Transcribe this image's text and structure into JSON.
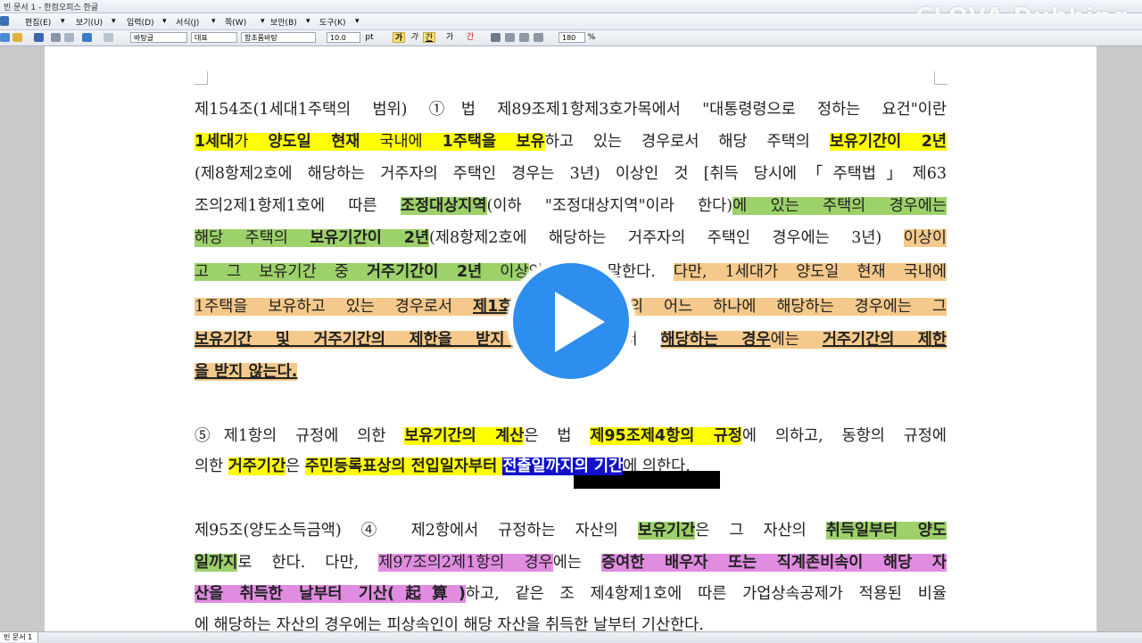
{
  "window": {
    "title": "빈 문서 1 - 한컴오피스 한글"
  },
  "watermark": "CLOVA Dubbing",
  "menu": [
    {
      "label": "편집(E)"
    },
    {
      "label": "보기(U)"
    },
    {
      "label": "입력(D)"
    },
    {
      "label": "서식(J)"
    },
    {
      "label": "쪽(W)"
    },
    {
      "label": "보안(B)"
    },
    {
      "label": "도구(K)"
    }
  ],
  "toolbar": {
    "style_value": "바탕글",
    "lang_value": "대표",
    "font_value": "함초롬바탕",
    "size_value": "10.0",
    "size_unit": "pt",
    "bold_label": "가",
    "italic_label": "가",
    "underline_label": "간",
    "strike_label": "가",
    "color_label": "간",
    "zoom_value": "180",
    "zoom_unit": "%"
  },
  "document": {
    "lines": [
      [
        {
          "t": "제154조(1세대1주택의 범위) ①법 제89조제1항제3호가목에서 \"대통령령으로 정하는 요건\"이란"
        }
      ],
      [
        {
          "t": "1세대",
          "h": "y",
          "b": 1
        },
        {
          "t": "가 ",
          "h": "y"
        },
        {
          "t": "양도일 현재",
          "h": "y",
          "b": 1
        },
        {
          "t": " 국내에 ",
          "h": "y"
        },
        {
          "t": "1주택을 보유",
          "h": "y",
          "b": 1
        },
        {
          "t": "하고 있는 경우로서 해당 주택의 "
        },
        {
          "t": "보유기간이 2년",
          "h": "y",
          "b": 1
        }
      ],
      [
        {
          "t": "(제8항제2호에 해당하는 거주자의 주택인 경우는 3년) 이상인 것 [취득 당시에「주택법」제63"
        }
      ],
      [
        {
          "t": "조의2제1항제1호에 따른 "
        },
        {
          "t": "조정대상지역",
          "h": "g",
          "b": 1
        },
        {
          "t": "(이하 \"조정대상지역\"이라 한다)"
        },
        {
          "t": "에 있는 주택의 경우에는",
          "h": "g"
        }
      ],
      [
        {
          "t": "해당 주택의 ",
          "h": "g"
        },
        {
          "t": "보유기간이 2년",
          "h": "g",
          "b": 1
        },
        {
          "t": "(제8항제2호에 해당하는 거주자의 주택인 경우에는 3년) "
        },
        {
          "t": "이상이",
          "h": "o"
        }
      ],
      [
        {
          "t": "고 그 보유기간 중 ",
          "h": "g"
        },
        {
          "t": "거주기간이 2년",
          "h": "g",
          "b": 1
        },
        {
          "t": " 이상",
          "h": "g"
        },
        {
          "t": "인 것을 말한다. "
        },
        {
          "t": "다만, 1세대가 양도일 현재 국내에",
          "h": "o"
        }
      ],
      [
        {
          "t": "1주택을 보유하고 있는 경우로서 ",
          "h": "o"
        },
        {
          "t": "제1호",
          "h": "o",
          "b": 1,
          "u": 1
        },
        {
          "t": "부터 제3호까지의 어느 하나에 해당하는 경우에는 그",
          "h": "o"
        }
      ],
      [
        {
          "t": "보유기간 및 거주기간의 제한을 받지 않는",
          "h": "o",
          "b": 1,
          "u": 1
        },
        {
          "t": " 경우로서 "
        },
        {
          "t": "해당하는 경우",
          "h": "o",
          "b": 1,
          "u": 1
        },
        {
          "t": "에는 ",
          "h": "o"
        },
        {
          "t": "거주기간의 제한",
          "h": "o",
          "b": 1,
          "u": 1
        }
      ],
      [
        {
          "t": "을 받지 않는다.",
          "h": "o",
          "b": 1,
          "u": 1
        }
      ],
      [
        {
          "t": ""
        }
      ],
      [
        {
          "t": "⑤제1항의 규정에 의한 "
        },
        {
          "t": "보유기간의 계산",
          "h": "y",
          "b": 1
        },
        {
          "t": "은 법 "
        },
        {
          "t": "제95조제4항의 규정",
          "h": "y",
          "b": 1
        },
        {
          "t": "에 의하고, 동항의 규정에"
        }
      ],
      [
        {
          "t": "의한 "
        },
        {
          "t": "거주기간",
          "h": "y",
          "b": 1
        },
        {
          "t": "은 "
        },
        {
          "t": "주민등록표상의 전입일자부터 ",
          "h": "y",
          "b": 1
        },
        {
          "t": "전출일까지의 기간",
          "h": "s",
          "b": 1
        },
        {
          "t": "에 의한다."
        }
      ],
      [
        {
          "t": ""
        }
      ],
      [
        {
          "t": ""
        }
      ],
      [
        {
          "t": "제95조(양도소득금액) ④ 제2항에서 규정하는 자산의 "
        },
        {
          "t": "보유기간",
          "h": "g",
          "b": 1
        },
        {
          "t": "은 그 자산의 "
        },
        {
          "t": "취득일부터 양도",
          "h": "g",
          "b": 1
        }
      ],
      [
        {
          "t": "일까지",
          "h": "g",
          "b": 1
        },
        {
          "t": "로 한다. 다만, "
        },
        {
          "t": "제97조의2제1항의 경우",
          "h": "p"
        },
        {
          "t": "에는 "
        },
        {
          "t": "증여한 배우자 또는 직계존비속이 해당 자",
          "h": "p",
          "b": 1
        }
      ],
      [
        {
          "t": "산을 취득한 날부터 기산(起算)",
          "h": "p",
          "b": 1
        },
        {
          "t": "하고, 같은 조 제4항제1호에 따른 가업상속공제가 적용된 비율"
        }
      ],
      [
        {
          "t": "에 해당하는 자산의 경우에는 피상속인이 해당 자산을 취득한 날부터 기산한다."
        }
      ]
    ]
  },
  "status": {
    "tab_label": "빈 문서 1"
  },
  "colors": {
    "highlight_yellow": "#ffff00",
    "highlight_green": "#9dd16a",
    "highlight_orange": "#f4c98b",
    "highlight_pink": "#e08ce0",
    "selection": "#1010cc",
    "play_button": "#2d8ef0"
  }
}
